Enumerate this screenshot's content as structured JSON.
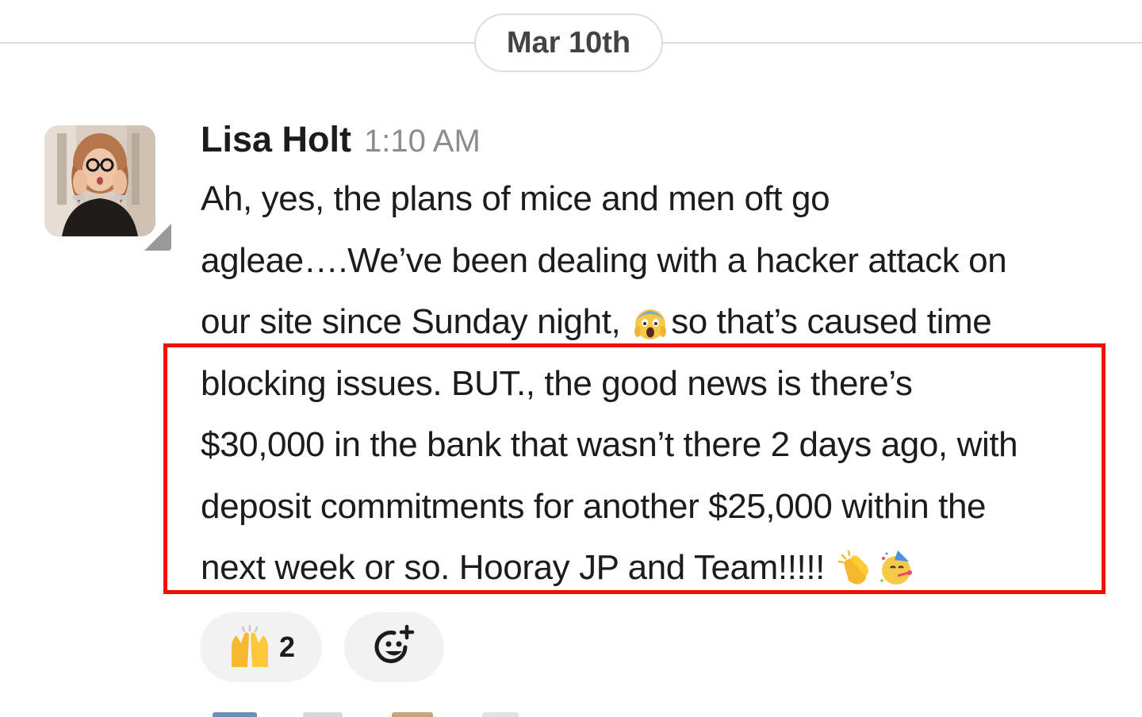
{
  "date_divider": {
    "label": "Mar 10th"
  },
  "message": {
    "sender": "Lisa Holt",
    "time": "1:10 AM",
    "lines": [
      "Ah, yes, the plans of mice and men oft go",
      "agleae….We’ve been dealing with a hacker attack on",
      "our site since Sunday night,",
      "so that’s caused time",
      "blocking issues. BUT., the good news is there’s",
      "$30,000 in the bank that wasn’t there 2 days ago, with",
      "deposit commitments for another $25,000 within the",
      "next week or so. Hooray JP and Team!!!!!"
    ],
    "inline_emojis": [
      "scream-emoji",
      "clapping-hands-emoji",
      "partying-face-emoji"
    ]
  },
  "reactions": [
    {
      "emoji": "raising-hands-emoji",
      "count": "2"
    },
    {
      "emoji": "add-reaction-icon",
      "count": ""
    }
  ],
  "colors": {
    "highlight_border": "#f20f00",
    "reaction_bg": "#f2f2f2",
    "timestamp": "#8d8b8d"
  }
}
